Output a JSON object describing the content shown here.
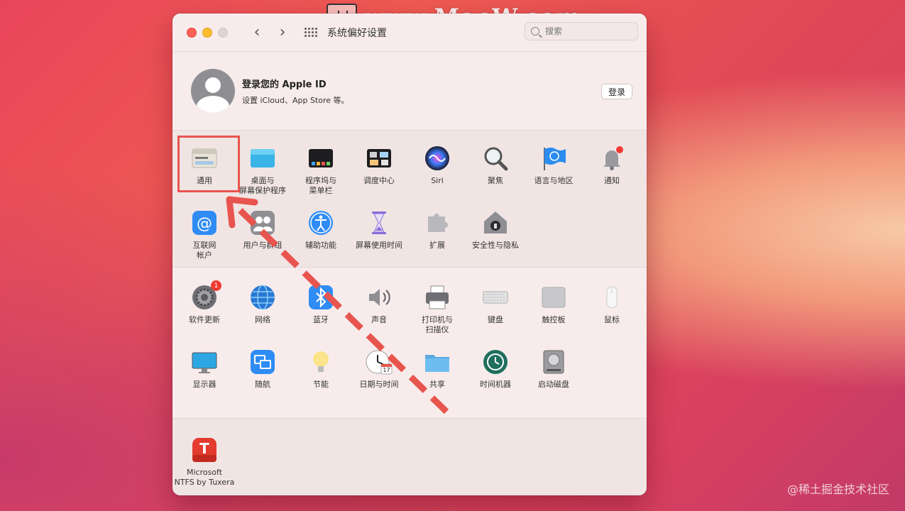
{
  "watermark": {
    "text": "www.MacW.com",
    "corner": "@稀土掘金技术社区"
  },
  "window": {
    "title": "系统偏好设置"
  },
  "search": {
    "placeholder": "搜索"
  },
  "account": {
    "title": "登录您的 Apple ID",
    "subtitle": "设置 iCloud、App Store 等。",
    "login_button": "登录"
  },
  "section1": [
    {
      "name": "general",
      "label": "通用",
      "icon": "general-icon"
    },
    {
      "name": "desktop",
      "label": "桌面与\n屏幕保护程序",
      "icon": "desktop-icon"
    },
    {
      "name": "dock",
      "label": "程序坞与\n菜单栏",
      "icon": "dock-icon"
    },
    {
      "name": "mission-control",
      "label": "调度中心",
      "icon": "mission-control-icon"
    },
    {
      "name": "siri",
      "label": "Siri",
      "icon": "siri-icon"
    },
    {
      "name": "spotlight",
      "label": "聚焦",
      "icon": "spotlight-icon"
    },
    {
      "name": "language",
      "label": "语言与地区",
      "icon": "flag-icon"
    },
    {
      "name": "notifications",
      "label": "通知",
      "icon": "bell-icon"
    },
    {
      "name": "internet-accounts",
      "label": "互联网\n帐户",
      "icon": "at-icon"
    },
    {
      "name": "users",
      "label": "用户与群组",
      "icon": "users-icon"
    },
    {
      "name": "accessibility",
      "label": "辅助功能",
      "icon": "accessibility-icon"
    },
    {
      "name": "screen-time",
      "label": "屏幕使用时间",
      "icon": "hourglass-icon"
    },
    {
      "name": "extensions",
      "label": "扩展",
      "icon": "puzzle-icon"
    },
    {
      "name": "security",
      "label": "安全性与隐私",
      "icon": "house-lock-icon"
    }
  ],
  "section2": [
    {
      "name": "software-update",
      "label": "软件更新",
      "icon": "gear-icon",
      "badge": "1"
    },
    {
      "name": "network",
      "label": "网络",
      "icon": "globe-icon"
    },
    {
      "name": "bluetooth",
      "label": "蓝牙",
      "icon": "bluetooth-icon"
    },
    {
      "name": "sound",
      "label": "声音",
      "icon": "speaker-icon"
    },
    {
      "name": "printers",
      "label": "打印机与\n扫描仪",
      "icon": "printer-icon"
    },
    {
      "name": "keyboard",
      "label": "键盘",
      "icon": "keyboard-icon"
    },
    {
      "name": "trackpad",
      "label": "触控板",
      "icon": "trackpad-icon"
    },
    {
      "name": "mouse",
      "label": "鼠标",
      "icon": "mouse-icon"
    },
    {
      "name": "displays",
      "label": "显示器",
      "icon": "display-icon"
    },
    {
      "name": "sidecar",
      "label": "随航",
      "icon": "sidecar-icon"
    },
    {
      "name": "energy",
      "label": "节能",
      "icon": "bulb-icon"
    },
    {
      "name": "date-time",
      "label": "日期与时间",
      "icon": "clock-icon",
      "date": "17"
    },
    {
      "name": "sharing",
      "label": "共享",
      "icon": "folder-icon"
    },
    {
      "name": "time-machine",
      "label": "时间机器",
      "icon": "time-machine-icon"
    },
    {
      "name": "startup-disk",
      "label": "启动磁盘",
      "icon": "disk-icon"
    }
  ],
  "section3": [
    {
      "name": "ntfs",
      "label": "Microsoft\nNTFS by Tuxera",
      "icon": "tuxera-icon",
      "letter": "T"
    }
  ],
  "colors": {
    "highlight": "#e8554e",
    "accent": "#2f7df6"
  }
}
